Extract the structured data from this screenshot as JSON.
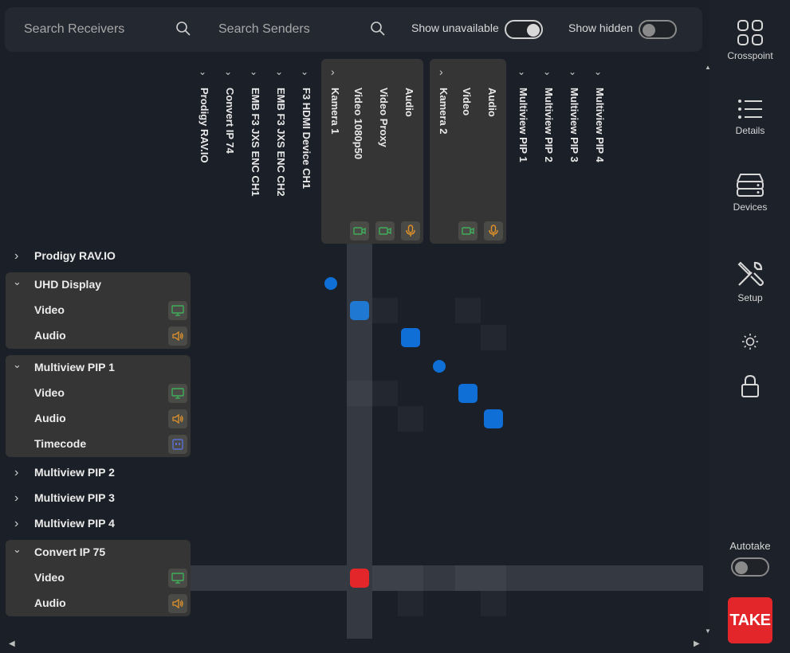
{
  "search": {
    "receivers_placeholder": "Search Receivers",
    "senders_placeholder": "Search Senders",
    "show_unavailable": {
      "label": "Show unavailable",
      "on": true
    },
    "show_hidden": {
      "label": "Show hidden",
      "on": false
    }
  },
  "nav": {
    "crosspoint": "Crosspoint",
    "details": "Details",
    "devices": "Devices",
    "setup": "Setup",
    "autotake": "Autotake",
    "autotake_on": false,
    "take": "TAKE"
  },
  "senders": [
    {
      "label": "Prodigy RAV.IO",
      "expanded": false
    },
    {
      "label": "Convert IP 74",
      "expanded": false
    },
    {
      "label": "EMB F3 JXS ENC CH1",
      "expanded": false
    },
    {
      "label": "EMB F3 JXS ENC CH2",
      "expanded": false
    },
    {
      "label": "F3 HDMI Device CH1",
      "expanded": false
    },
    {
      "label": "Kamera 1",
      "expanded": true,
      "flows": [
        "Video 1080p50",
        "Video Proxy",
        "Audio"
      ]
    },
    {
      "label": "Kamera 2",
      "expanded": true,
      "flows": [
        "Video",
        "Audio"
      ]
    },
    {
      "label": "Multiview PIP 1",
      "expanded": false
    },
    {
      "label": "Multiview PIP 2",
      "expanded": false
    },
    {
      "label": "Multiview PIP 3",
      "expanded": false
    },
    {
      "label": "Multiview PIP 4",
      "expanded": false
    }
  ],
  "receivers": [
    {
      "label": "Prodigy RAV.IO",
      "expanded": false
    },
    {
      "label": "UHD Display",
      "expanded": true,
      "flows": [
        {
          "label": "Video",
          "type": "video"
        },
        {
          "label": "Audio",
          "type": "audio"
        }
      ]
    },
    {
      "label": "Multiview PIP 1",
      "expanded": true,
      "flows": [
        {
          "label": "Video",
          "type": "video"
        },
        {
          "label": "Audio",
          "type": "audio"
        },
        {
          "label": "Timecode",
          "type": "data"
        }
      ]
    },
    {
      "label": "Multiview PIP 2",
      "expanded": false
    },
    {
      "label": "Multiview PIP 3",
      "expanded": false
    },
    {
      "label": "Multiview PIP 4",
      "expanded": false
    },
    {
      "label": "Convert IP 75",
      "expanded": true,
      "flows": [
        {
          "label": "Video",
          "type": "video"
        },
        {
          "label": "Audio",
          "type": "audio"
        }
      ]
    }
  ],
  "crosspoints": [
    {
      "receiver": "UHD Display / Video",
      "sender": "Kamera 1 / Video 1080p50",
      "state": "active"
    },
    {
      "receiver": "UHD Display / Audio",
      "sender": "Kamera 1 / Audio",
      "state": "active"
    },
    {
      "receiver": "Multiview PIP 1 / Video",
      "sender": "Kamera 2 / Video",
      "state": "active"
    },
    {
      "receiver": "Multiview PIP 1 / Audio",
      "sender": "Kamera 2 / Audio",
      "state": "active"
    },
    {
      "receiver": "Convert IP 75 / Video",
      "sender": "Kamera 1 / Video 1080p50",
      "state": "pending"
    }
  ],
  "colors": {
    "active": "#0f6fd6",
    "pending": "#e3262a",
    "video": "#3fae5a",
    "audio": "#e0922a",
    "data": "#5a6fd6"
  }
}
